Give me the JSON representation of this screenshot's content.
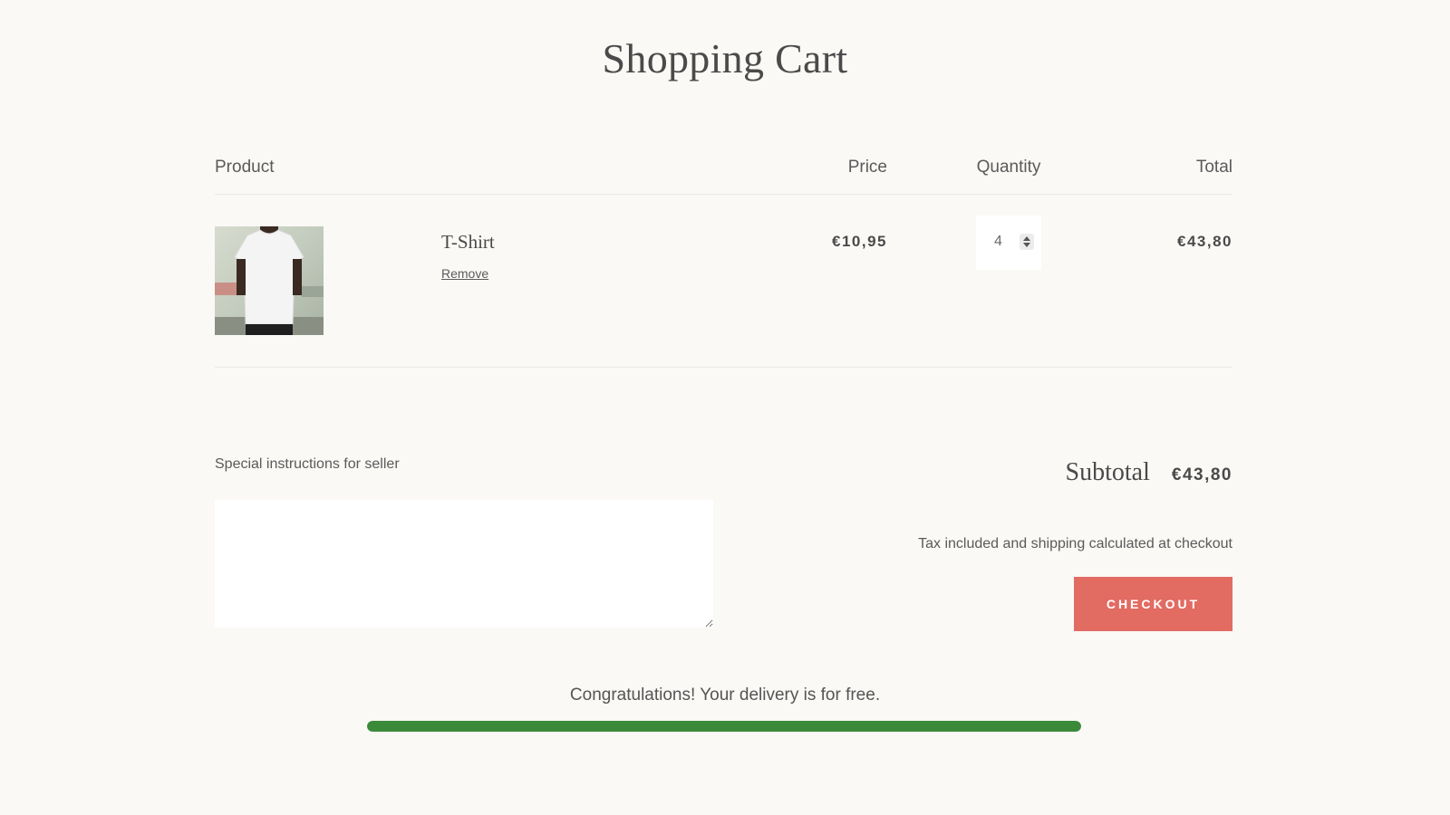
{
  "page": {
    "title": "Shopping Cart"
  },
  "cart": {
    "headers": {
      "product": "Product",
      "price": "Price",
      "quantity": "Quantity",
      "total": "Total"
    },
    "items": [
      {
        "name": "T-Shirt",
        "remove_label": "Remove",
        "price": "€10,95",
        "quantity": "4",
        "total": "€43,80",
        "image_icon": "tshirt-product-photo"
      }
    ]
  },
  "instructions": {
    "label": "Special instructions for seller",
    "value": ""
  },
  "summary": {
    "subtotal_label": "Subtotal",
    "subtotal_value": "€43,80",
    "tax_note": "Tax included and shipping calculated at checkout",
    "checkout_label": "CHECKOUT"
  },
  "delivery": {
    "message": "Congratulations! Your delivery is for free.",
    "progress_percent": 100
  },
  "colors": {
    "background": "#faf9f6",
    "checkout": "#e26b62",
    "progress": "#3b8a3a"
  }
}
